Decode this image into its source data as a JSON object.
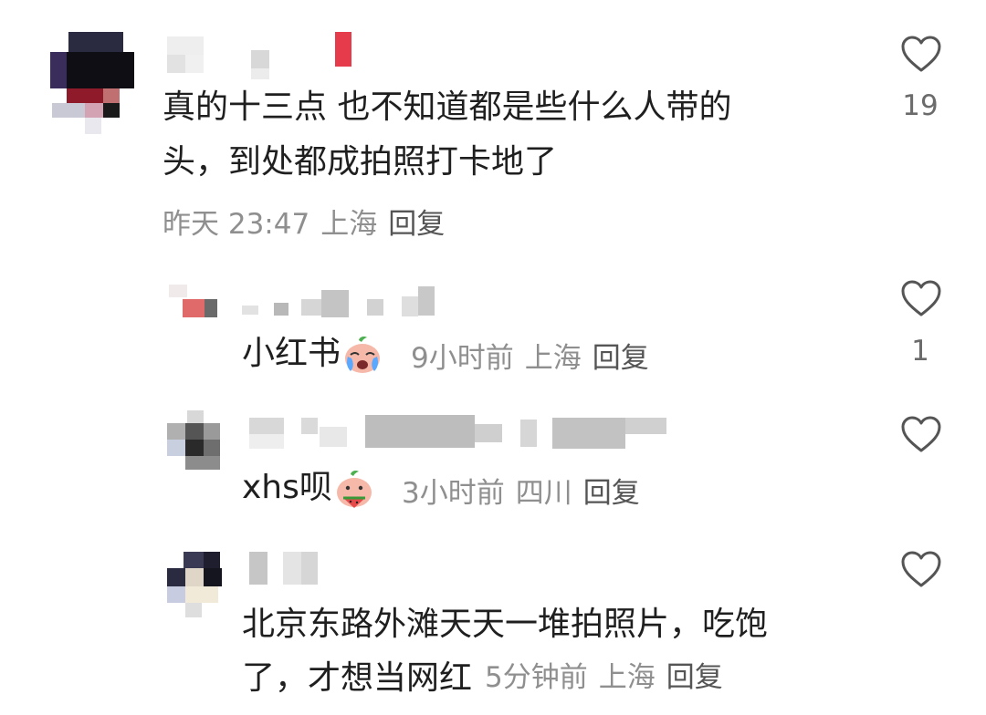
{
  "comments": [
    {
      "text_line1": "真的十三点 也不知道都是些什么人带的",
      "text_line2": "头，到处都成拍照打卡地了",
      "time": "昨天 23:47",
      "location": "上海",
      "reply_label": "回复",
      "like_count": "19",
      "icon": "heart-outline-icon"
    },
    {
      "text": "小红书",
      "emoji": "crying-peach-emoji",
      "time": "9小时前",
      "location": "上海",
      "reply_label": "回复",
      "like_count": "1",
      "icon": "heart-outline-icon"
    },
    {
      "text": "xhs呗",
      "emoji": "peach-eating-watermelon-emoji",
      "time": "3小时前",
      "location": "四川",
      "reply_label": "回复",
      "like_count": "",
      "icon": "heart-outline-icon"
    },
    {
      "text_line1": "北京东路外滩天天一堆拍照片，吃饱",
      "text_line2": "了，才想当网红",
      "time": "5分钟前",
      "location": "上海",
      "reply_label": "回复",
      "like_count": "",
      "icon": "heart-outline-icon"
    }
  ]
}
